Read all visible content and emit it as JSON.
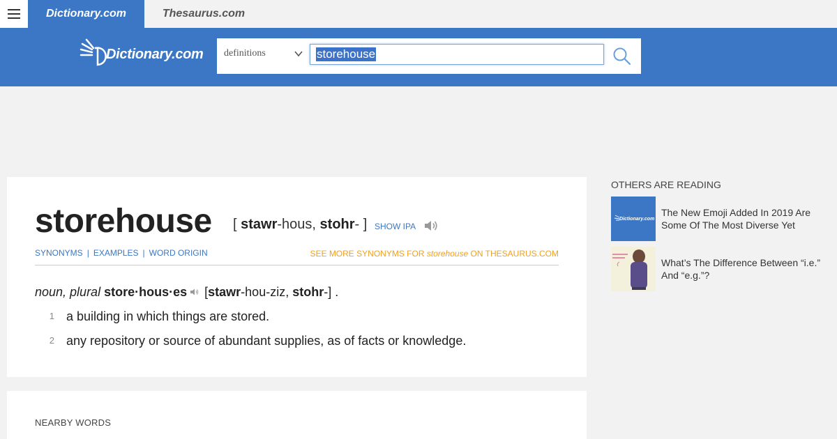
{
  "topbar": {
    "tabs": [
      {
        "label": "Dictionary.com"
      },
      {
        "label": "Thesaurus.com"
      }
    ]
  },
  "header": {
    "logo_text": "Dictionary.com",
    "search": {
      "select_value": "definitions",
      "query": "storehouse"
    },
    "colors": {
      "brand": "#3b77c4",
      "accent_orange": "#f0a020"
    }
  },
  "entry": {
    "headword": "storehouse",
    "pron": {
      "open": "[ ",
      "stress1": "stawr",
      "rest1": "-hous, ",
      "stress2": "stohr",
      "rest2": "- ]"
    },
    "show_ipa": "SHOW IPA",
    "subnav": [
      "SYNONYMS",
      "EXAMPLES",
      "WORD ORIGIN"
    ],
    "more_synonyms": {
      "prefix": "SEE MORE SYNONYMS FOR ",
      "word": "storehouse",
      "suffix": " ON THESAURUS.COM"
    },
    "pos": {
      "label": "noun, plural",
      "plural": "store·hous·es",
      "open": " [",
      "stress1": "stawr",
      "rest1": "-hou-ziz, ",
      "stress2": "stohr",
      "rest2": "-] ."
    },
    "definitions": [
      {
        "num": "1",
        "text": "a building in which things are stored."
      },
      {
        "num": "2",
        "text": "any repository or source of abundant supplies, as of facts or knowledge."
      }
    ]
  },
  "nearby": {
    "title": "NEARBY WORDS"
  },
  "sidebar": {
    "title": "OTHERS ARE READING",
    "articles": [
      {
        "title": "The New Emoji Added In 2019 Are Some Of The Most Diverse Yet",
        "thumb_label": "Dictionary.com"
      },
      {
        "title": "What’s The Difference Between “i.e.” And “e.g.”?"
      }
    ]
  }
}
